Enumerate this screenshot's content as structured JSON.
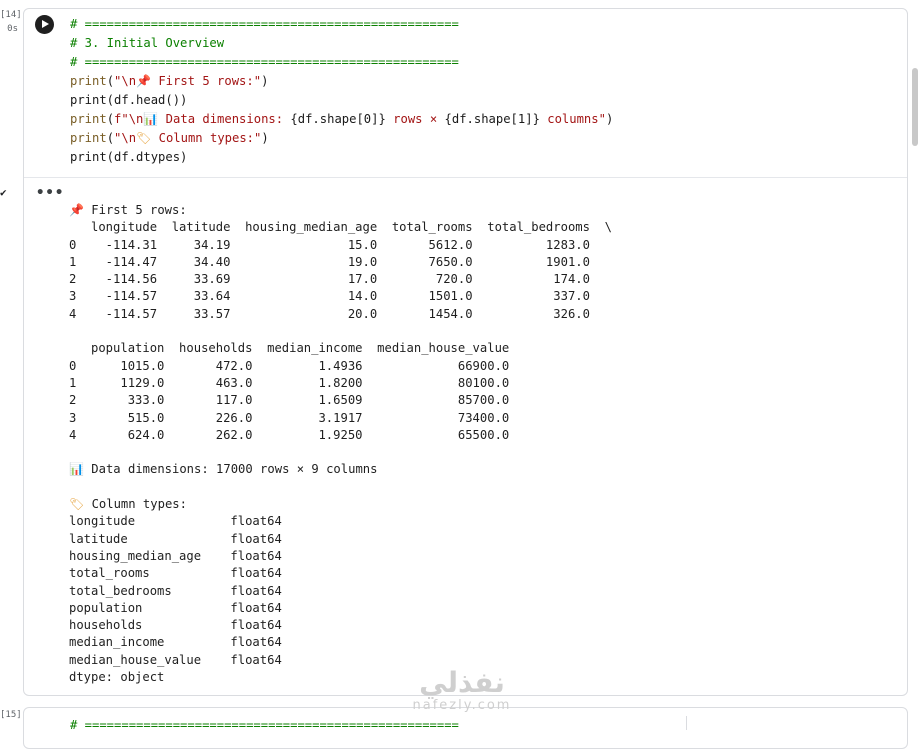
{
  "gutter": {
    "exec_count": "[14]",
    "exec_time": "0s",
    "next_exec_count": "[15]",
    "check_icon": "✔"
  },
  "code_cell": {
    "lines": {
      "l1": "# ===================================================",
      "l2": "# 3. Initial Overview",
      "l3": "# ===================================================",
      "l4a": "print",
      "l4b": "(",
      "l4s1": "\"\\n",
      "l4emo": "📌",
      "l4s2": " First 5 rows:\"",
      "l4c": ")",
      "l5": "print(df.head())",
      "l6a": "print",
      "l6b": "(",
      "l6s1": "f\"\\n",
      "l6emo": "📊",
      "l6s2": " Data dimensions: ",
      "l6v1": "{df.shape[0]}",
      "l6s3": " rows × ",
      "l6v2": "{df.shape[1]}",
      "l6s4": " columns\"",
      "l6c": ")",
      "l7a": "print",
      "l7b": "(",
      "l7s1": "\"\\n",
      "l7emo": "🏷",
      "l7s2": " Column types:\"",
      "l7c": ")",
      "l8": "print(df.dtypes)"
    }
  },
  "output_menu": "•••",
  "output": {
    "head_title": " First 5 rows:",
    "table1_header": "   longitude  latitude  housing_median_age  total_rooms  total_bedrooms  \\",
    "table1_rows": [
      "0    -114.31     34.19                15.0       5612.0          1283.0",
      "1    -114.47     34.40                19.0       7650.0          1901.0",
      "2    -114.56     33.69                17.0        720.0           174.0",
      "3    -114.57     33.64                14.0       1501.0           337.0",
      "4    -114.57     33.57                20.0       1454.0           326.0"
    ],
    "table2_header": "   population  households  median_income  median_house_value",
    "table2_rows": [
      "0      1015.0       472.0         1.4936             66900.0",
      "1      1129.0       463.0         1.8200             80100.0",
      "2       333.0       117.0         1.6509             85700.0",
      "3       515.0       226.0         3.1917             73400.0",
      "4       624.0       262.0         1.9250             65500.0"
    ],
    "dims_text": " Data dimensions: 17000 rows × 9 columns",
    "types_title": " Column types:",
    "dtypes": [
      "longitude             float64",
      "latitude              float64",
      "housing_median_age    float64",
      "total_rooms           float64",
      "total_bedrooms        float64",
      "population            float64",
      "households            float64",
      "median_income         float64",
      "median_house_value    float64"
    ],
    "dtype_footer": "dtype: object"
  },
  "next_cell_line": "# ===================================================",
  "watermark": {
    "arabic": "نفذلي",
    "latin": "nafezly.com"
  },
  "icons": {
    "pin": "📌",
    "chart": "📊",
    "tag": "🏷"
  }
}
